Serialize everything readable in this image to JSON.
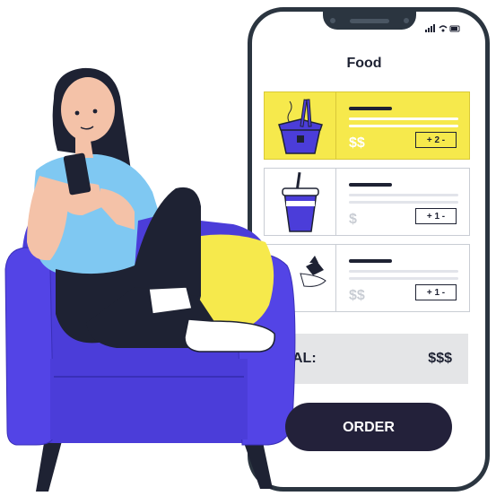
{
  "screen": {
    "title": "Food",
    "items": [
      {
        "price": "$$",
        "quantity": "+ 2 -",
        "icon": "noodle-box-icon",
        "active": true
      },
      {
        "price": "$",
        "quantity": "+ 1 -",
        "icon": "drink-cup-icon",
        "active": false
      },
      {
        "price": "$$",
        "quantity": "+ 1 -",
        "icon": "salad-bowl-icon",
        "active": false
      }
    ],
    "total_label": "AL:",
    "total_value": "$$$",
    "order_label": "ORDER"
  },
  "colors": {
    "accent_yellow": "#f6e94c",
    "brand_purple": "#4b3dd9",
    "dark": "#1e2233"
  }
}
